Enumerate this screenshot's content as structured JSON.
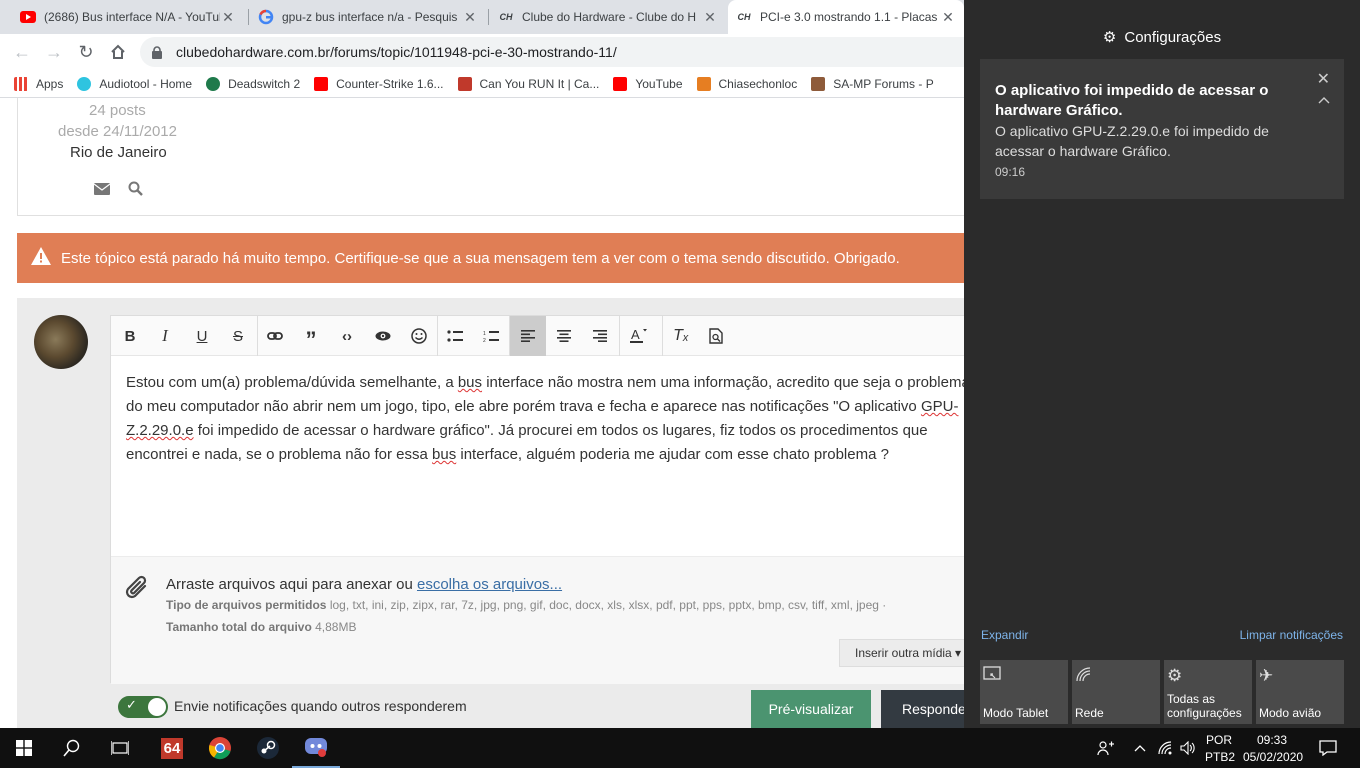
{
  "browser": {
    "tabs": [
      {
        "title": "(2686) Bus interface N/A - YouTub",
        "favicon": "youtube-icon",
        "close": "✕",
        "active": false
      },
      {
        "title": "gpu-z bus interface n/a - Pesquis",
        "favicon": "google-icon",
        "close": "✕",
        "active": false
      },
      {
        "title": "Clube do Hardware - Clube do H",
        "favicon": "cdh-icon",
        "close": "✕",
        "active": false
      },
      {
        "title": "PCI-e 3.0 mostrando 1.1 - Placas",
        "favicon": "cdh-icon",
        "close": "✕",
        "active": true
      }
    ],
    "favicon_text": "CH",
    "url": "clubedohardware.com.br/forums/topic/1011948-pci-e-30-mostrando-11/",
    "bookmarks": [
      {
        "label": "Apps",
        "icon": "apps-grid-icon",
        "color": "#ea4335"
      },
      {
        "label": "Audiotool - Home",
        "icon": "audiotool-icon",
        "color": "#2ec4e0"
      },
      {
        "label": "Deadswitch 2",
        "icon": "deadswitch-icon",
        "color": "#1f7a4b"
      },
      {
        "label": "Counter-Strike 1.6...",
        "icon": "youtube-icon",
        "color": "#ff0000"
      },
      {
        "label": "Can You RUN It | Ca...",
        "icon": "canyourunit-icon",
        "color": "#c0392b"
      },
      {
        "label": "YouTube",
        "icon": "youtube-icon",
        "color": "#ff0000"
      },
      {
        "label": "Chiasechonloc",
        "icon": "chiasechonloc-icon",
        "color": "#e67e22"
      },
      {
        "label": "SA-MP Forums - P",
        "icon": "samp-icon",
        "color": "#8e5b3a"
      }
    ]
  },
  "profile": {
    "posts": "24 posts",
    "since": "desde 24/11/2012",
    "location": "Rio de Janeiro"
  },
  "warning": {
    "text": "Este tópico está parado há muito tempo. Certifique-se que a sua mensagem tem a ver com o tema sendo discutido. Obrigado.",
    "color": "#e07e55"
  },
  "editor": {
    "toolbar": [
      "B",
      "I",
      "U",
      "S",
      "link",
      "quote",
      "code",
      "preview",
      "emoji",
      "bullet-list",
      "numbered-list",
      "align-left",
      "align-center",
      "align-right",
      "text-color",
      "clear-format",
      "source"
    ],
    "body": {
      "p1": "Estou com um(a) problema/dúvida semelhante, a ",
      "w1": "bus",
      "p2": " interface não mostra nem uma informação, acredito que seja o problema do meu computador não abrir nem um jogo, tipo, ele abre porém trava e fecha e aparece nas notificações \"O aplicativo ",
      "w2": "GPU-Z.2.29.0.e",
      "p3": " foi impedido de acessar o hardware gráfico\". Já procurei em todos os lugares, fiz todos os procedimentos que encontrei e nada, se o problema não for essa ",
      "w3": "bus",
      "p4": " interface, alguém poderia me ajudar com esse chato problema ?"
    },
    "attach": {
      "drag_text": "Arraste arquivos aqui para anexar ou ",
      "choose_link": "escolha os arquivos...",
      "types_label": "Tipo de arquivos permitidos",
      "types_value": "log, txt, ini, zip, zipx, rar, 7z, jpg, png, gif, doc, docx, xls, xlsx, pdf, ppt, pps, pptx, bmp, csv, tiff, xml, jpeg ·",
      "size_label": "Tamanho total do arquivo",
      "size_value": "4,88MB",
      "insert_media": "Inserir outra mídia ▾"
    }
  },
  "footer": {
    "notify_label": "Envie notificações quando outros responderem",
    "preview_button": "Pré-visualizar",
    "reply_button": "Responder"
  },
  "action_center": {
    "header": "Configurações",
    "toast": {
      "title": "O aplicativo foi impedido de acessar o hardware Gráfico.",
      "body": "O aplicativo GPU-Z.2.29.0.e foi impedido de acessar o hardware Gráfico.",
      "time": "09:16"
    },
    "expand": "Expandir",
    "clear": "Limpar notificações",
    "quick_actions": [
      {
        "label": "Modo Tablet",
        "icon": "tablet-mode-icon"
      },
      {
        "label": "Rede",
        "icon": "network-icon"
      },
      {
        "label": "Todas as configurações",
        "icon": "settings-gear-icon"
      },
      {
        "label": "Modo avião",
        "icon": "airplane-icon"
      }
    ]
  },
  "taskbar": {
    "badge_text": "64",
    "lang1": "POR",
    "lang2": "PTB2",
    "time": "09:33",
    "date": "05/02/2020"
  }
}
